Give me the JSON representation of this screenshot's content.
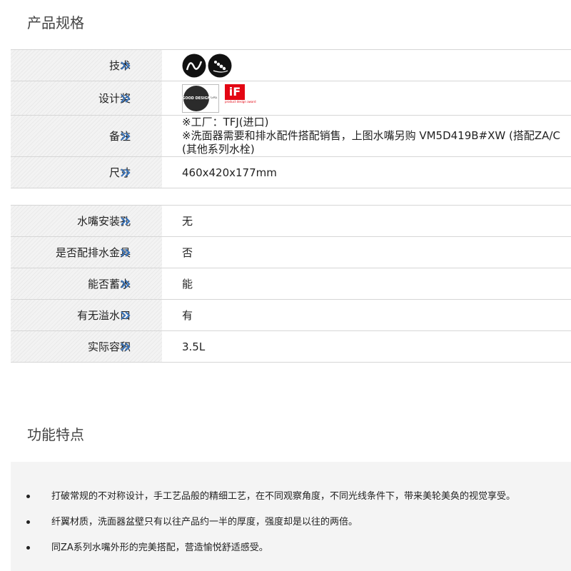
{
  "spec_section": {
    "title": "产品规格"
  },
  "spec_table_1": [
    {
      "label": "技术",
      "type": "tech-icons",
      "icons": [
        "flow-arc-icon",
        "dot-stream-icon"
      ]
    },
    {
      "label": "设计奖",
      "type": "awards",
      "awards": {
        "good_design": {
          "circle": "GOOD DESIGN",
          "text": "GREEN GOOD DESIGN AWARD 2018"
        },
        "if": {
          "mark": "iF",
          "caption": "product design award"
        }
      }
    },
    {
      "label": "备注",
      "type": "remark",
      "lines": [
        "※工厂：TFJ(进口)",
        "※洗面器需要和排水配件搭配销售，上图水嘴另购 VM5D419B#XW (搭配ZA/C",
        "(其他系列水栓)"
      ]
    },
    {
      "label": "尺寸",
      "type": "text",
      "value": "460x420x177mm"
    }
  ],
  "spec_table_2": [
    {
      "label": "水嘴安装孔",
      "value": "无"
    },
    {
      "label": "是否配排水金具",
      "value": "否"
    },
    {
      "label": "能否蓄水",
      "value": "能"
    },
    {
      "label": "有无溢水口",
      "value": "有"
    },
    {
      "label": "实际容积",
      "value": "3.5L"
    }
  ],
  "feature_section": {
    "title": "功能特点",
    "items": [
      "打破常规的不对称设计，手工艺品般的精细工艺，在不同观察角度，不同光线条件下，带来美轮美奂的视觉享受。",
      "纤翼材质，洗面器盆壁只有以往产品约一半的厚度，强度却是以往的两倍。",
      "同ZA系列水嘴外形的完美搭配，营造愉悦舒适感受。"
    ]
  },
  "colors": {
    "chevron": "#3a73b8",
    "if_red": "#e30613",
    "border": "#d6d6d6",
    "feature_bg": "#f4f4f4"
  }
}
